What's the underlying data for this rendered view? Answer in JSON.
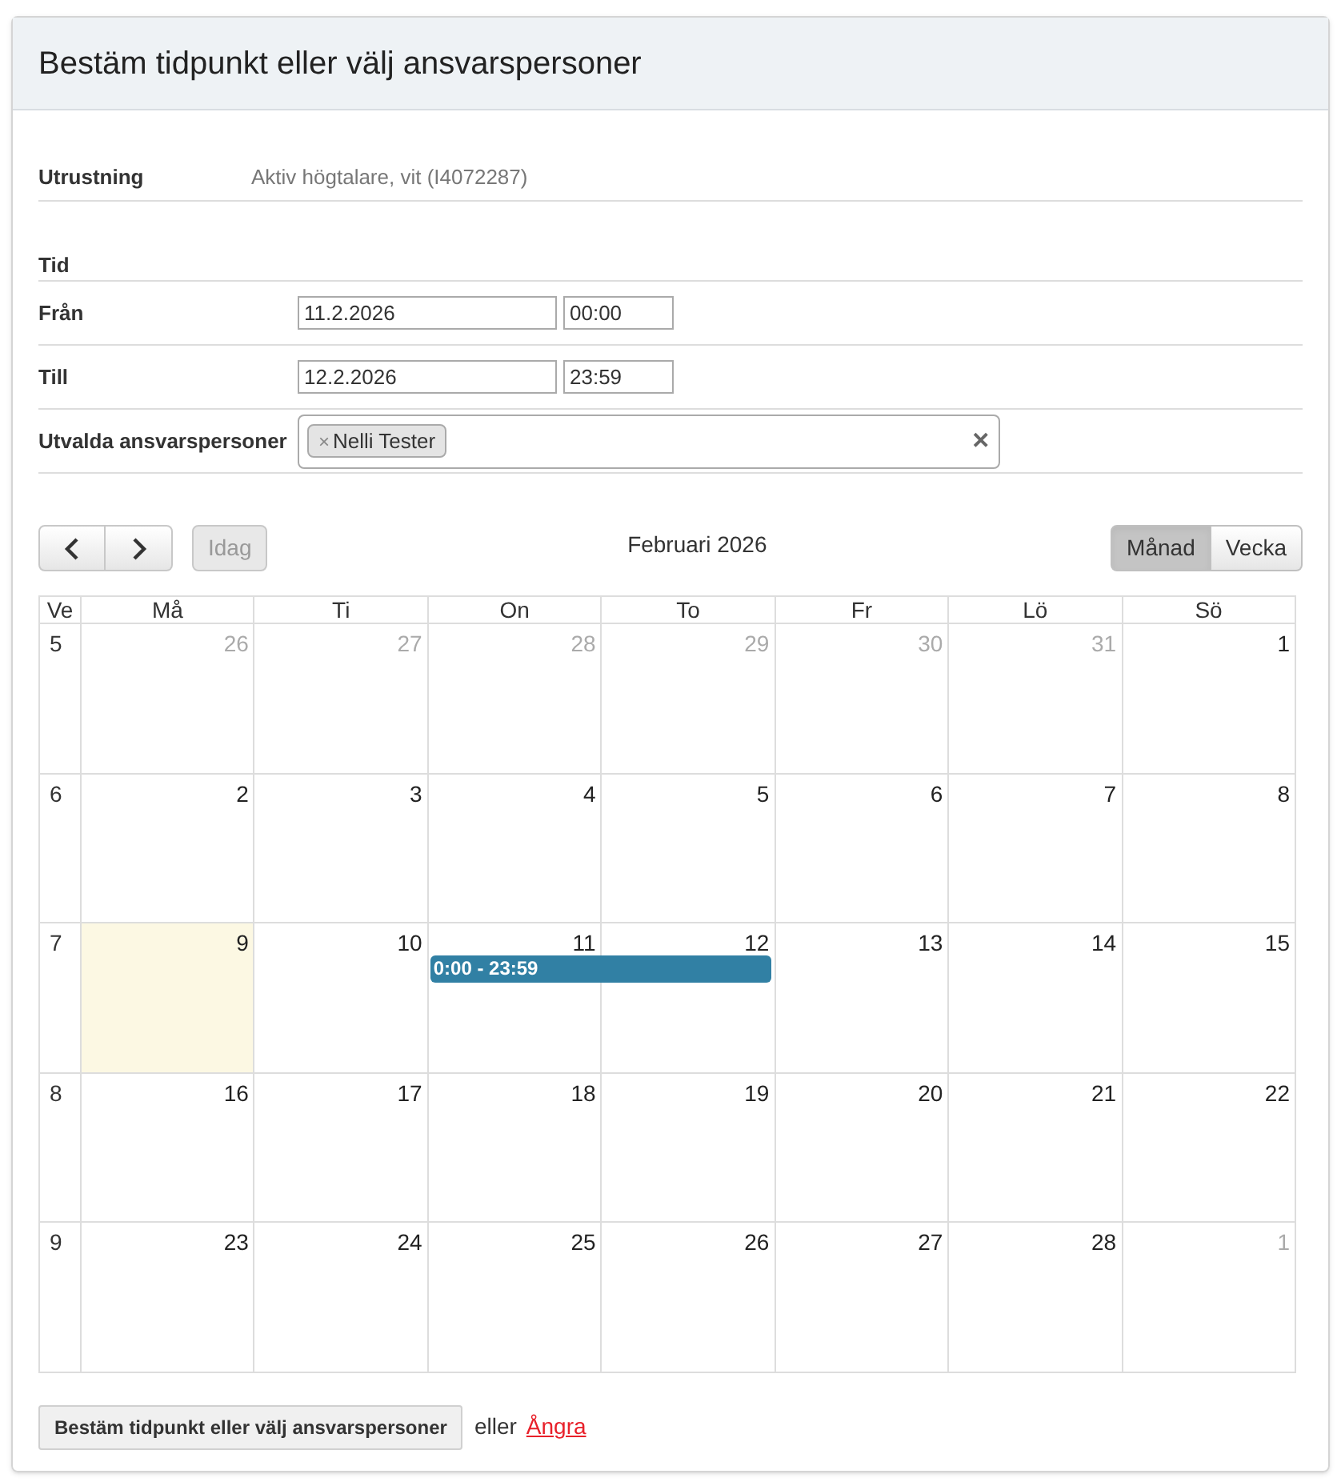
{
  "title": "Bestäm tidpunkt eller välj ansvarspersoner",
  "equipment": {
    "label": "Utrustning",
    "value": "Aktiv högtalare, vit (I4072287)"
  },
  "time": {
    "heading": "Tid",
    "rows": [
      {
        "label": "Från",
        "date": "11.2.2026",
        "time": "00:00"
      },
      {
        "label": "Till",
        "date": "12.2.2026",
        "time": "23:59"
      }
    ]
  },
  "persons": {
    "label": "Utvalda ansvarspersoner",
    "tags": [
      {
        "remove": "×",
        "name": "Nelli Tester"
      }
    ],
    "clear": "✕"
  },
  "calendar": {
    "today_button": "Idag",
    "today_disabled": true,
    "month_title": "Februari 2026",
    "views": [
      {
        "label": "Månad",
        "selected": true
      },
      {
        "label": "Vecka",
        "selected": false
      }
    ],
    "columns": [
      "Ve",
      "Må",
      "Ti",
      "On",
      "To",
      "Fr",
      "Lö",
      "Sö"
    ],
    "weeks": [
      {
        "week": "5",
        "days": [
          {
            "day": "26",
            "other_month": true,
            "today": false,
            "in_event": false
          },
          {
            "day": "27",
            "other_month": true,
            "today": false,
            "in_event": false
          },
          {
            "day": "28",
            "other_month": true,
            "today": false,
            "in_event": false
          },
          {
            "day": "29",
            "other_month": true,
            "today": false,
            "in_event": false
          },
          {
            "day": "30",
            "other_month": true,
            "today": false,
            "in_event": false
          },
          {
            "day": "31",
            "other_month": true,
            "today": false,
            "in_event": false
          },
          {
            "day": "1",
            "other_month": false,
            "today": false,
            "in_event": false
          }
        ]
      },
      {
        "week": "6",
        "days": [
          {
            "day": "2",
            "other_month": false,
            "today": false,
            "in_event": false
          },
          {
            "day": "3",
            "other_month": false,
            "today": false,
            "in_event": false
          },
          {
            "day": "4",
            "other_month": false,
            "today": false,
            "in_event": false
          },
          {
            "day": "5",
            "other_month": false,
            "today": false,
            "in_event": false
          },
          {
            "day": "6",
            "other_month": false,
            "today": false,
            "in_event": false
          },
          {
            "day": "7",
            "other_month": false,
            "today": false,
            "in_event": false
          },
          {
            "day": "8",
            "other_month": false,
            "today": false,
            "in_event": false
          }
        ]
      },
      {
        "week": "7",
        "days": [
          {
            "day": "9",
            "other_month": false,
            "today": true,
            "in_event": false
          },
          {
            "day": "10",
            "other_month": false,
            "today": false,
            "in_event": false
          },
          {
            "day": "11",
            "other_month": false,
            "today": false,
            "in_event": true
          },
          {
            "day": "12",
            "other_month": false,
            "today": false,
            "in_event": true
          },
          {
            "day": "13",
            "other_month": false,
            "today": false,
            "in_event": false
          },
          {
            "day": "14",
            "other_month": false,
            "today": false,
            "in_event": false
          },
          {
            "day": "15",
            "other_month": false,
            "today": false,
            "in_event": false
          }
        ],
        "events": [
          {
            "label": "0:00 - 23:59"
          }
        ]
      },
      {
        "week": "8",
        "days": [
          {
            "day": "16",
            "other_month": false,
            "today": false,
            "in_event": false
          },
          {
            "day": "17",
            "other_month": false,
            "today": false,
            "in_event": false
          },
          {
            "day": "18",
            "other_month": false,
            "today": false,
            "in_event": false
          },
          {
            "day": "19",
            "other_month": false,
            "today": false,
            "in_event": false
          },
          {
            "day": "20",
            "other_month": false,
            "today": false,
            "in_event": false
          },
          {
            "day": "21",
            "other_month": false,
            "today": false,
            "in_event": false
          },
          {
            "day": "22",
            "other_month": false,
            "today": false,
            "in_event": false
          }
        ]
      },
      {
        "week": "9",
        "days": [
          {
            "day": "23",
            "other_month": false,
            "today": false,
            "in_event": false
          },
          {
            "day": "24",
            "other_month": false,
            "today": false,
            "in_event": false
          },
          {
            "day": "25",
            "other_month": false,
            "today": false,
            "in_event": false
          },
          {
            "day": "26",
            "other_month": false,
            "today": false,
            "in_event": false
          },
          {
            "day": "27",
            "other_month": false,
            "today": false,
            "in_event": false
          },
          {
            "day": "28",
            "other_month": false,
            "today": false,
            "in_event": false
          },
          {
            "day": "1",
            "other_month": true,
            "today": false,
            "in_event": false
          }
        ]
      }
    ]
  },
  "footer": {
    "submit": "Bestäm tidpunkt eller välj ansvarspersoner",
    "or": "eller",
    "cancel": "Ångra"
  }
}
